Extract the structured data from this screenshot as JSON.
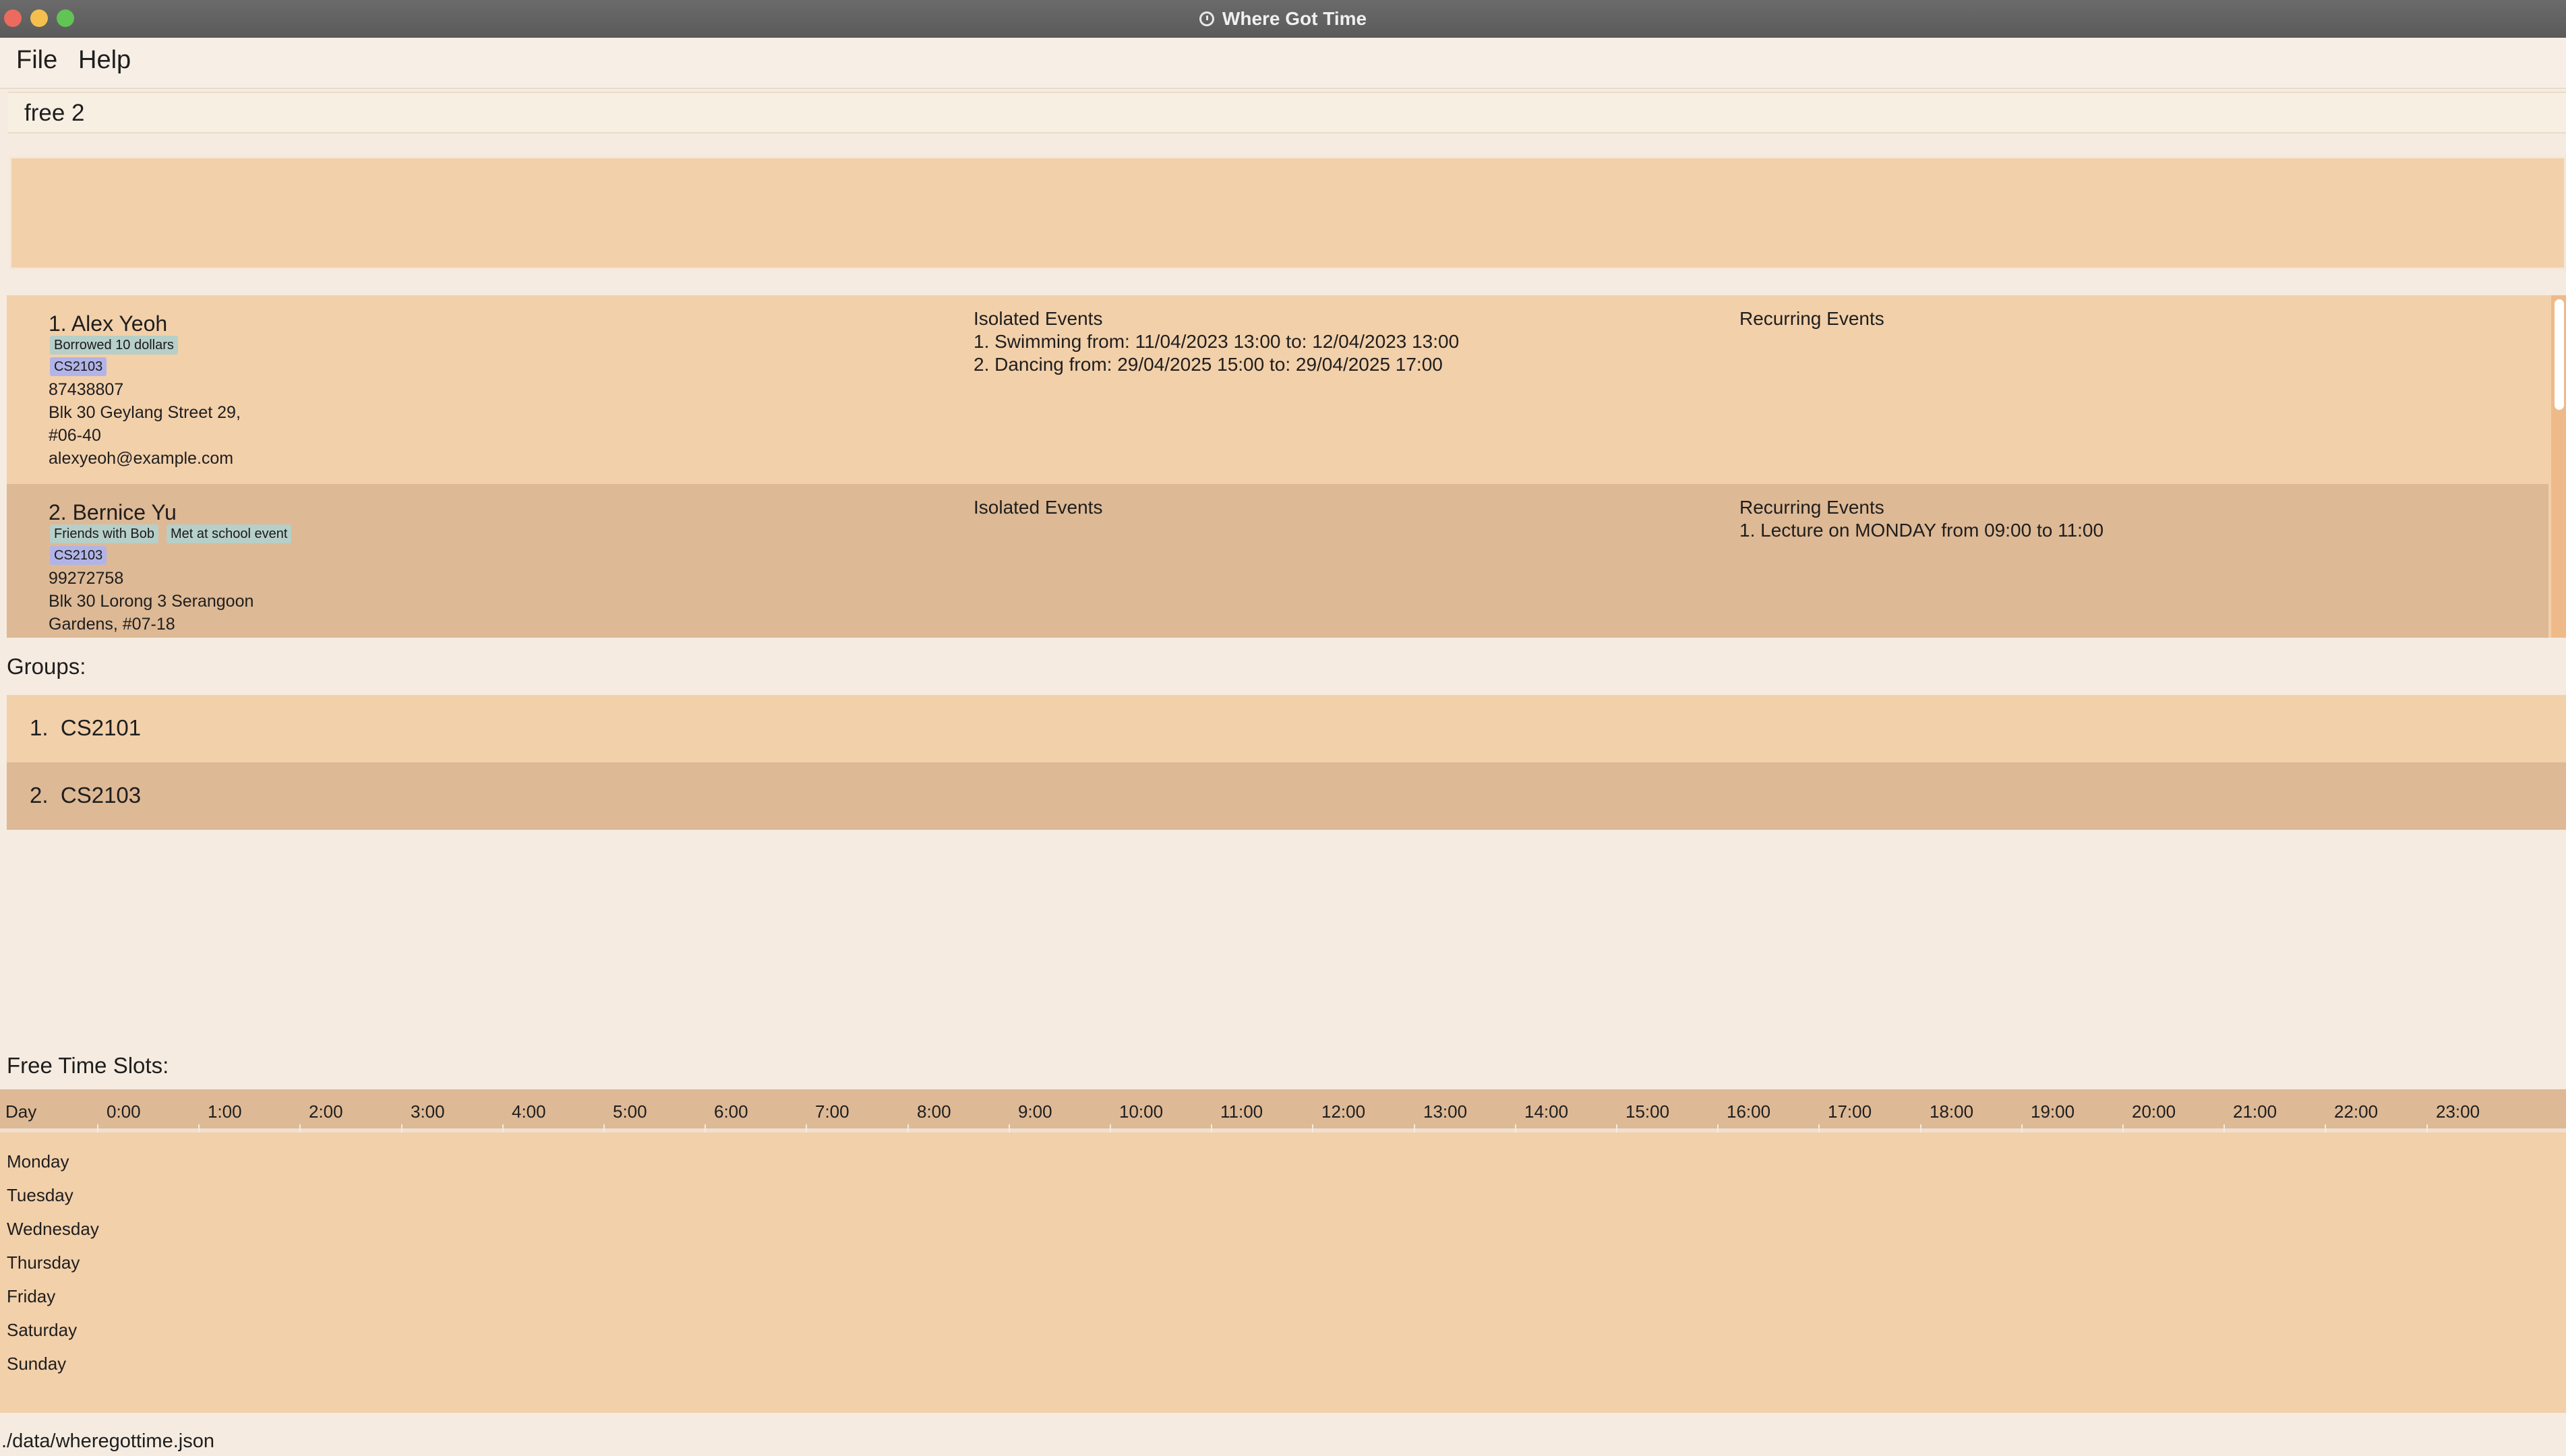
{
  "window": {
    "title": "Where Got Time"
  },
  "menu": {
    "file": "File",
    "help": "Help"
  },
  "command": {
    "value": "free 2"
  },
  "persons": [
    {
      "name": "1. Alex Yeoh",
      "tags": [
        "Borrowed 10 dollars"
      ],
      "groups": [
        "CS2103"
      ],
      "phone": "87438807",
      "address_line1": "Blk 30 Geylang Street 29,",
      "address_line2": "#06-40",
      "email": "alexyeoh@example.com",
      "isolated_header": "Isolated Events",
      "isolated_events": [
        "1. Swimming from: 11/04/2023 13:00 to: 12/04/2023 13:00",
        "2. Dancing from: 29/04/2025 15:00 to: 29/04/2025 17:00"
      ],
      "recurring_header": "Recurring Events",
      "recurring_events": []
    },
    {
      "name": "2. Bernice Yu",
      "tags": [
        "Friends with Bob",
        "Met at school event"
      ],
      "groups": [
        "CS2103"
      ],
      "phone": "99272758",
      "address_line1": "Blk 30 Lorong 3 Serangoon",
      "address_line2": "Gardens, #07-18",
      "isolated_header": "Isolated Events",
      "isolated_events": [],
      "recurring_header": "Recurring Events",
      "recurring_events": [
        "1. Lecture on MONDAY from 09:00 to 11:00"
      ]
    }
  ],
  "groups": {
    "label": "Groups:",
    "items": [
      {
        "index": "1.",
        "name": "CS2101"
      },
      {
        "index": "2.",
        "name": "CS2103"
      }
    ]
  },
  "free_slots": {
    "label": "Free Time Slots:",
    "day_header": "Day",
    "hours": [
      "0:00",
      "1:00",
      "2:00",
      "3:00",
      "4:00",
      "5:00",
      "6:00",
      "7:00",
      "8:00",
      "9:00",
      "10:00",
      "11:00",
      "12:00",
      "13:00",
      "14:00",
      "15:00",
      "16:00",
      "17:00",
      "18:00",
      "19:00",
      "20:00",
      "21:00",
      "22:00",
      "23:00"
    ],
    "days": [
      "Monday",
      "Tuesday",
      "Wednesday",
      "Thursday",
      "Friday",
      "Saturday",
      "Sunday"
    ]
  },
  "status": {
    "path": "./data/wheregottime.json"
  },
  "colors": {
    "background": "#f5ebe0",
    "panel": "#f2d0aa",
    "panel_alt": "#deb995",
    "tag": "#b7cfc9",
    "group_tag": "#b2b4e8"
  }
}
